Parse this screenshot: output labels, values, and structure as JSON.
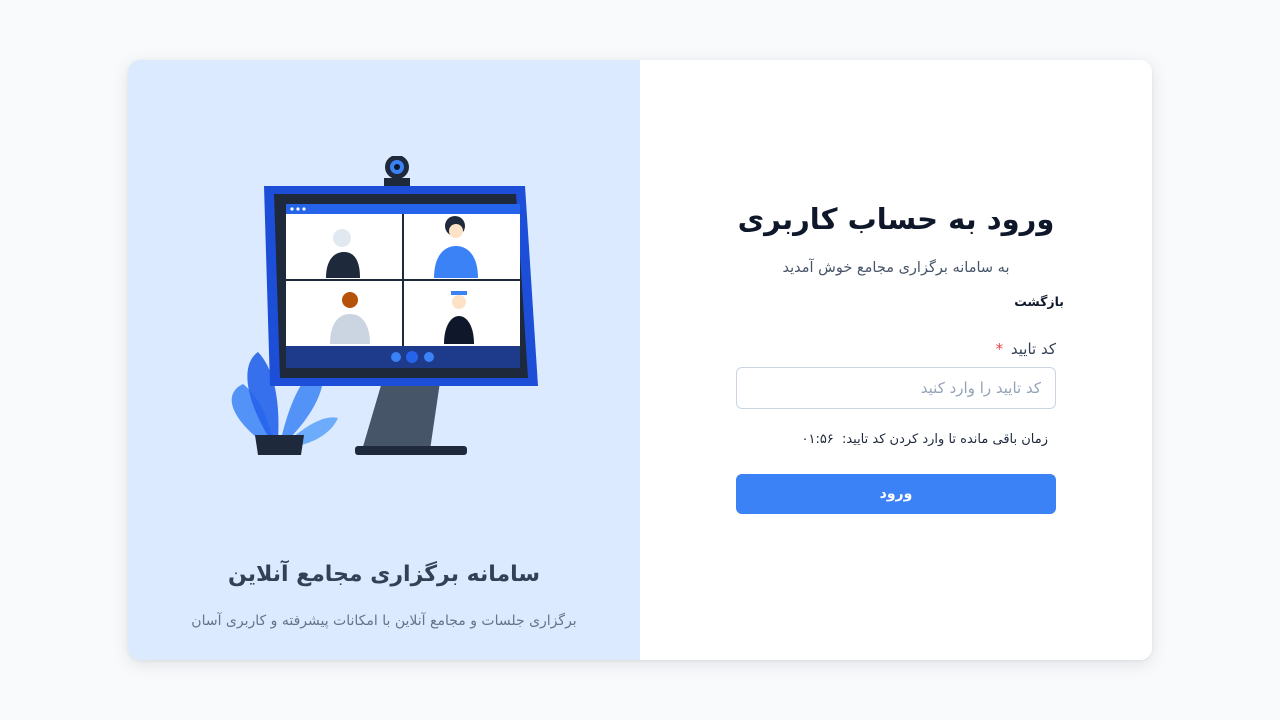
{
  "brand": {
    "title": "سامانه برگزاری مجامع آنلاین",
    "subtitle": "برگزاری جلسات و مجامع آنلاین با امکانات پیشرفته و کاربری آسان",
    "illustration": "video-conference-monitor-illustration"
  },
  "login": {
    "title": "ورود به حساب کاربری",
    "subtitle": "به سامانه برگزاری مجامع خوش آمدید",
    "back_label": "بازگشت",
    "code_label": "کد تایید",
    "required_mark": "*",
    "code_placeholder": "کد تایید را وارد کنید",
    "code_value": "",
    "timer_label": "زمان باقی مانده تا وارد کردن کد تایید:",
    "timer_value": "۰۱:۵۶",
    "submit_label": "ورود"
  },
  "colors": {
    "page_bg": "#f8fafc",
    "left_panel_bg": "#dbeafe",
    "primary": "#3b82f6",
    "required": "#ef4444"
  }
}
